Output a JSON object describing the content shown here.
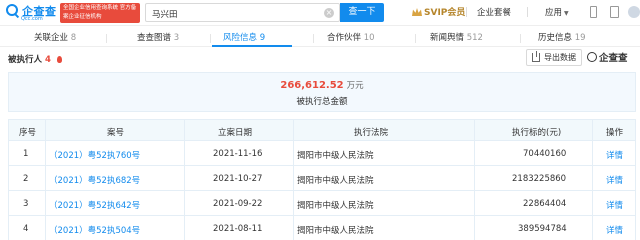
{
  "header": {
    "logo_text": "企查查",
    "logo_sub": "Qcc.com",
    "badge_text": "全国企业信用查询系统 官方备案企业征信机构",
    "search_value": "马兴田",
    "search_button": "查一下",
    "svip_label": "SVIP会员",
    "nav_enterprise": "企业套餐",
    "nav_apps": "应用"
  },
  "tabs": [
    {
      "label": "关联企业",
      "count": "8"
    },
    {
      "label": "查查图谱",
      "count": "3"
    },
    {
      "label": "风险信息",
      "count": "9"
    },
    {
      "label": "合作伙伴",
      "count": "10"
    },
    {
      "label": "新闻舆情",
      "count": "512"
    },
    {
      "label": "历史信息",
      "count": "19"
    }
  ],
  "section": {
    "title": "被执行人",
    "count": "4",
    "export_label": "导出数据",
    "watermark": "企查查"
  },
  "summary": {
    "amount": "266,612.52",
    "unit": "万元",
    "label": "被执行总金额"
  },
  "table": {
    "headers": [
      "序号",
      "案号",
      "立案日期",
      "执行法院",
      "执行标的(元)",
      "操作"
    ],
    "rows": [
      {
        "index": "1",
        "case_no": "（2021）粤52执760号",
        "date": "2021-11-16",
        "court": "揭阳市中级人民法院",
        "amount": "70440160",
        "action": "详情"
      },
      {
        "index": "2",
        "case_no": "（2021）粤52执682号",
        "date": "2021-10-27",
        "court": "揭阳市中级人民法院",
        "amount": "2183225860",
        "action": "详情"
      },
      {
        "index": "3",
        "case_no": "（2021）粤52执642号",
        "date": "2021-09-22",
        "court": "揭阳市中级人民法院",
        "amount": "22864404",
        "action": "详情"
      },
      {
        "index": "4",
        "case_no": "（2021）粤52执504号",
        "date": "2021-08-11",
        "court": "揭阳市中级人民法院",
        "amount": "389594784",
        "action": "详情"
      }
    ]
  },
  "colors": {
    "brand": "#128bed",
    "alert": "#e84b3c",
    "vip": "#b5852b"
  }
}
